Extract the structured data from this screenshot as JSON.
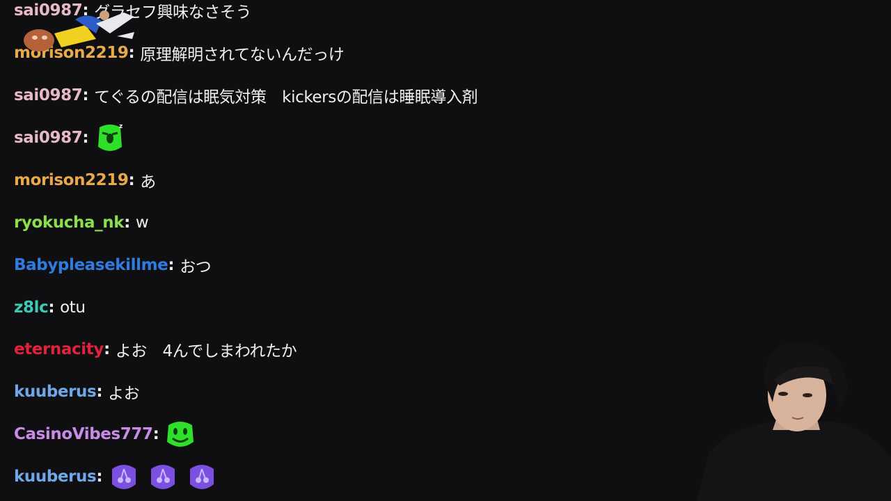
{
  "chat": {
    "messages": [
      {
        "user": "sai0987",
        "color": "#e6b8c9",
        "text": "グラセフ興味なさそう",
        "emotes": []
      },
      {
        "user": "morison2219",
        "color": "#e8a94a",
        "text": "原理解明されてないんだっけ",
        "emotes": []
      },
      {
        "user": "sai0987",
        "color": "#e6b8c9",
        "text": "てぐるの配信は眠気対策　kickersの配信は睡眠導入剤",
        "emotes": []
      },
      {
        "user": "sai0987",
        "color": "#e6b8c9",
        "text": "",
        "emotes": [
          "sleepy-green-emote"
        ]
      },
      {
        "user": "morison2219",
        "color": "#e8a94a",
        "text": "あ",
        "emotes": []
      },
      {
        "user": "ryokucha_nk",
        "color": "#8ae04a",
        "text": "w",
        "emotes": []
      },
      {
        "user": "Babypleasekillme",
        "color": "#2f7be0",
        "text": "おつ",
        "emotes": []
      },
      {
        "user": "z8lc",
        "color": "#3fc9b4",
        "text": "otu",
        "emotes": []
      },
      {
        "user": "eternacity",
        "color": "#e0233a",
        "text": "よお　4んでしまわれたか",
        "emotes": []
      },
      {
        "user": "kuuberus",
        "color": "#6fa8e8",
        "text": "よお",
        "emotes": []
      },
      {
        "user": "CasinoVibes777",
        "color": "#c98ae8",
        "text": "",
        "emotes": [
          "smile-green-emote"
        ]
      },
      {
        "user": "kuuberus",
        "color": "#6fa8e8",
        "text": "",
        "emotes": [
          "cherry-purple-emote",
          "cherry-purple-emote",
          "cherry-purple-emote"
        ]
      }
    ]
  },
  "colors": {
    "background": "#0f0f11",
    "message_text": "#efeff1",
    "emote_green": "#2fe02a",
    "emote_purple": "#7b4fe0"
  },
  "separator": ":"
}
